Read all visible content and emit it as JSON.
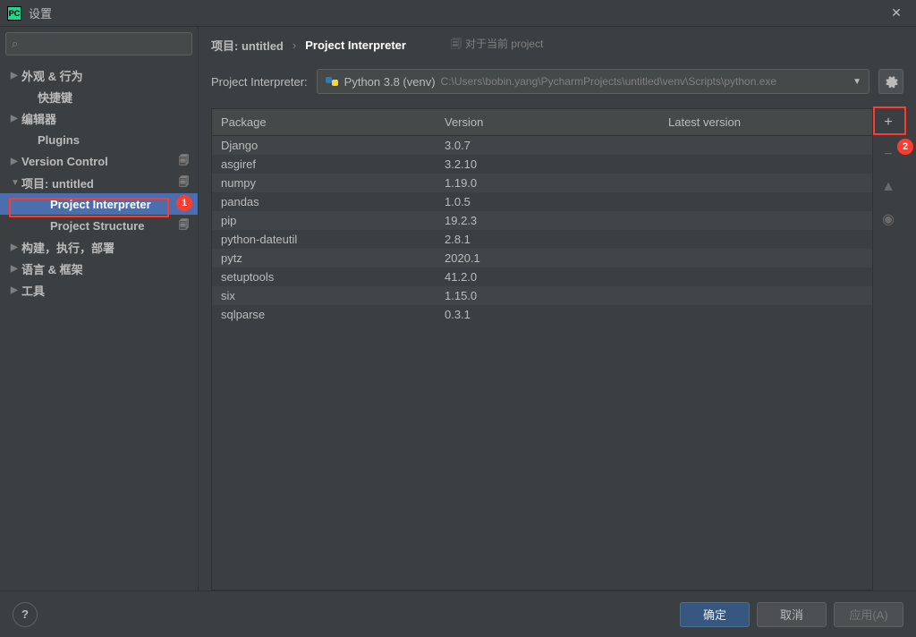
{
  "window": {
    "title": "设置",
    "icon": "PC"
  },
  "sidebar": {
    "search_placeholder": "",
    "items": [
      {
        "label": "外观 & 行为",
        "expandable": true,
        "expanded": false,
        "indent": 0
      },
      {
        "label": "快捷键",
        "expandable": false,
        "indent": 1
      },
      {
        "label": "编辑器",
        "expandable": true,
        "expanded": false,
        "indent": 0
      },
      {
        "label": "Plugins",
        "expandable": false,
        "indent": 1
      },
      {
        "label": "Version Control",
        "expandable": true,
        "expanded": false,
        "indent": 0,
        "badge": true
      },
      {
        "label": "项目: untitled",
        "expandable": true,
        "expanded": true,
        "indent": 0,
        "badge": true
      },
      {
        "label": "Project Interpreter",
        "expandable": false,
        "indent": 2,
        "badge": true,
        "selected": true
      },
      {
        "label": "Project Structure",
        "expandable": false,
        "indent": 2,
        "badge": true
      },
      {
        "label": "构建，执行，部署",
        "expandable": true,
        "expanded": false,
        "indent": 0
      },
      {
        "label": "语言 & 框架",
        "expandable": true,
        "expanded": false,
        "indent": 0
      },
      {
        "label": "工具",
        "expandable": true,
        "expanded": false,
        "indent": 0
      }
    ]
  },
  "breadcrumb": {
    "crumb1": "项目: untitled",
    "sep": "›",
    "crumb2": "Project Interpreter",
    "scope": "对于当前 project"
  },
  "interpreter": {
    "label": "Project Interpreter:",
    "name": "Python 3.8 (venv)",
    "path": "C:\\Users\\bobin.yang\\PycharmProjects\\untitled\\venv\\Scripts\\python.exe"
  },
  "packages": {
    "headers": {
      "pkg": "Package",
      "version": "Version",
      "latest": "Latest version"
    },
    "rows": [
      {
        "name": "Django",
        "version": "3.0.7",
        "latest": ""
      },
      {
        "name": "asgiref",
        "version": "3.2.10",
        "latest": ""
      },
      {
        "name": "numpy",
        "version": "1.19.0",
        "latest": ""
      },
      {
        "name": "pandas",
        "version": "1.0.5",
        "latest": ""
      },
      {
        "name": "pip",
        "version": "19.2.3",
        "latest": ""
      },
      {
        "name": "python-dateutil",
        "version": "2.8.1",
        "latest": ""
      },
      {
        "name": "pytz",
        "version": "2020.1",
        "latest": ""
      },
      {
        "name": "setuptools",
        "version": "41.2.0",
        "latest": ""
      },
      {
        "name": "six",
        "version": "1.15.0",
        "latest": ""
      },
      {
        "name": "sqlparse",
        "version": "0.3.1",
        "latest": ""
      }
    ]
  },
  "side_actions": {
    "add": "+",
    "remove": "−",
    "up": "▲",
    "eye": "◉"
  },
  "callouts": {
    "c1": "1",
    "c2": "2"
  },
  "footer": {
    "help": "?",
    "ok": "确定",
    "cancel": "取消",
    "apply": "应用(A)"
  }
}
